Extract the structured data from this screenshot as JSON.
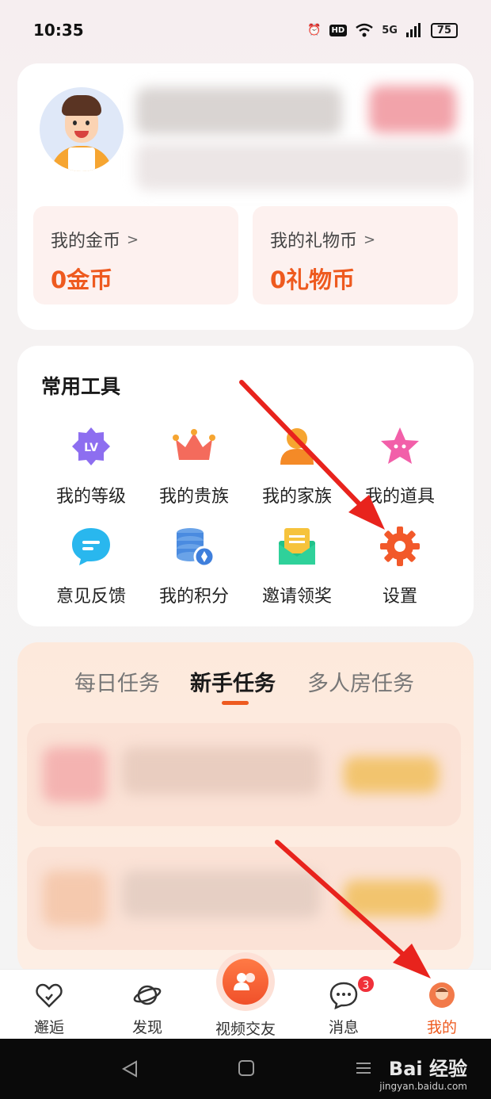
{
  "status_bar": {
    "time": "10:35",
    "hd": "HD",
    "network": "5G",
    "battery": "75"
  },
  "profile": {
    "wallet": [
      {
        "title": "我的金币",
        "value": "0金币"
      },
      {
        "title": "我的礼物币",
        "value": "0礼物币"
      }
    ]
  },
  "tools": {
    "title": "常用工具",
    "items": [
      {
        "label": "我的等级",
        "icon": "level-icon"
      },
      {
        "label": "我的贵族",
        "icon": "crown-icon"
      },
      {
        "label": "我的家族",
        "icon": "family-icon"
      },
      {
        "label": "我的道具",
        "icon": "star-icon"
      },
      {
        "label": "意见反馈",
        "icon": "feedback-icon"
      },
      {
        "label": "我的积分",
        "icon": "points-icon"
      },
      {
        "label": "邀请领奖",
        "icon": "invite-icon"
      },
      {
        "label": "设置",
        "icon": "gear-icon"
      }
    ],
    "level_badge": "LV"
  },
  "tasks": {
    "tabs": [
      "每日任务",
      "新手任务",
      "多人房任务"
    ],
    "active_tab": "新手任务"
  },
  "bottom_nav": {
    "items": [
      {
        "label": "邂逅",
        "icon": "heart-icon"
      },
      {
        "label": "发现",
        "icon": "planet-icon"
      },
      {
        "label": "视频交友",
        "icon": "video-friends-icon"
      },
      {
        "label": "消息",
        "icon": "message-icon",
        "badge": "3"
      },
      {
        "label": "我的",
        "icon": "profile-icon",
        "active": true
      }
    ]
  },
  "watermark": {
    "main": "Bai 经验",
    "sub": "jingyan.baidu.com"
  },
  "colors": {
    "accent": "#ee5a1f",
    "wallet_bg": "#fdf1ef",
    "task_bg": "#fde9dc",
    "arrow": "#e8231d"
  }
}
